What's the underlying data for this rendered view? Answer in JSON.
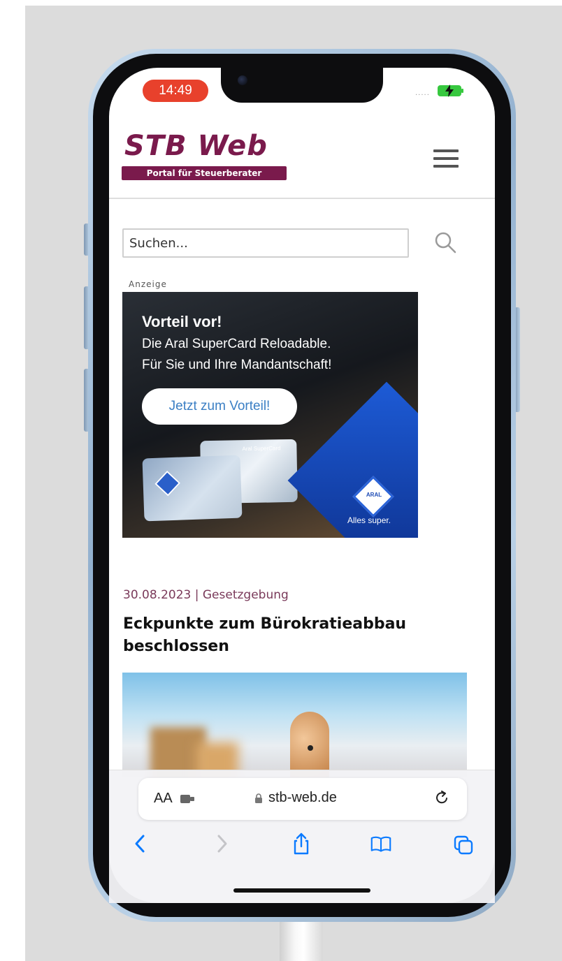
{
  "status_bar": {
    "time": "14:49",
    "signal": "....."
  },
  "site": {
    "logo_title": "STB Web",
    "logo_subtitle": "Portal für Steuerberater"
  },
  "search": {
    "placeholder": "Suchen..."
  },
  "ad": {
    "label": "Anzeige",
    "headline": "Vorteil vor!",
    "line1": "Die Aral SuperCard Reloadable.",
    "line2": "Für Sie und Ihre Mandantschaft!",
    "cta": "Jetzt zum Vorteil!",
    "brand": "ARAL",
    "slogan": "Alles super.",
    "card_label": "Aral SuperCard"
  },
  "article": {
    "meta": "30.08.2023 | Gesetzgebung",
    "title": "Eckpunkte zum Bürokratieabbau beschlossen"
  },
  "browser": {
    "text_size_label": "AA",
    "url": "stb-web.de",
    "icons": [
      "back-icon",
      "forward-icon",
      "share-icon",
      "bookmarks-icon",
      "tabs-icon",
      "reload-icon",
      "lock-icon",
      "extension-icon"
    ]
  },
  "colors": {
    "brand": "#7a1a4c",
    "time_pill": "#e8412c",
    "battery": "#37c83f",
    "ios_blue": "#0a7aff"
  }
}
